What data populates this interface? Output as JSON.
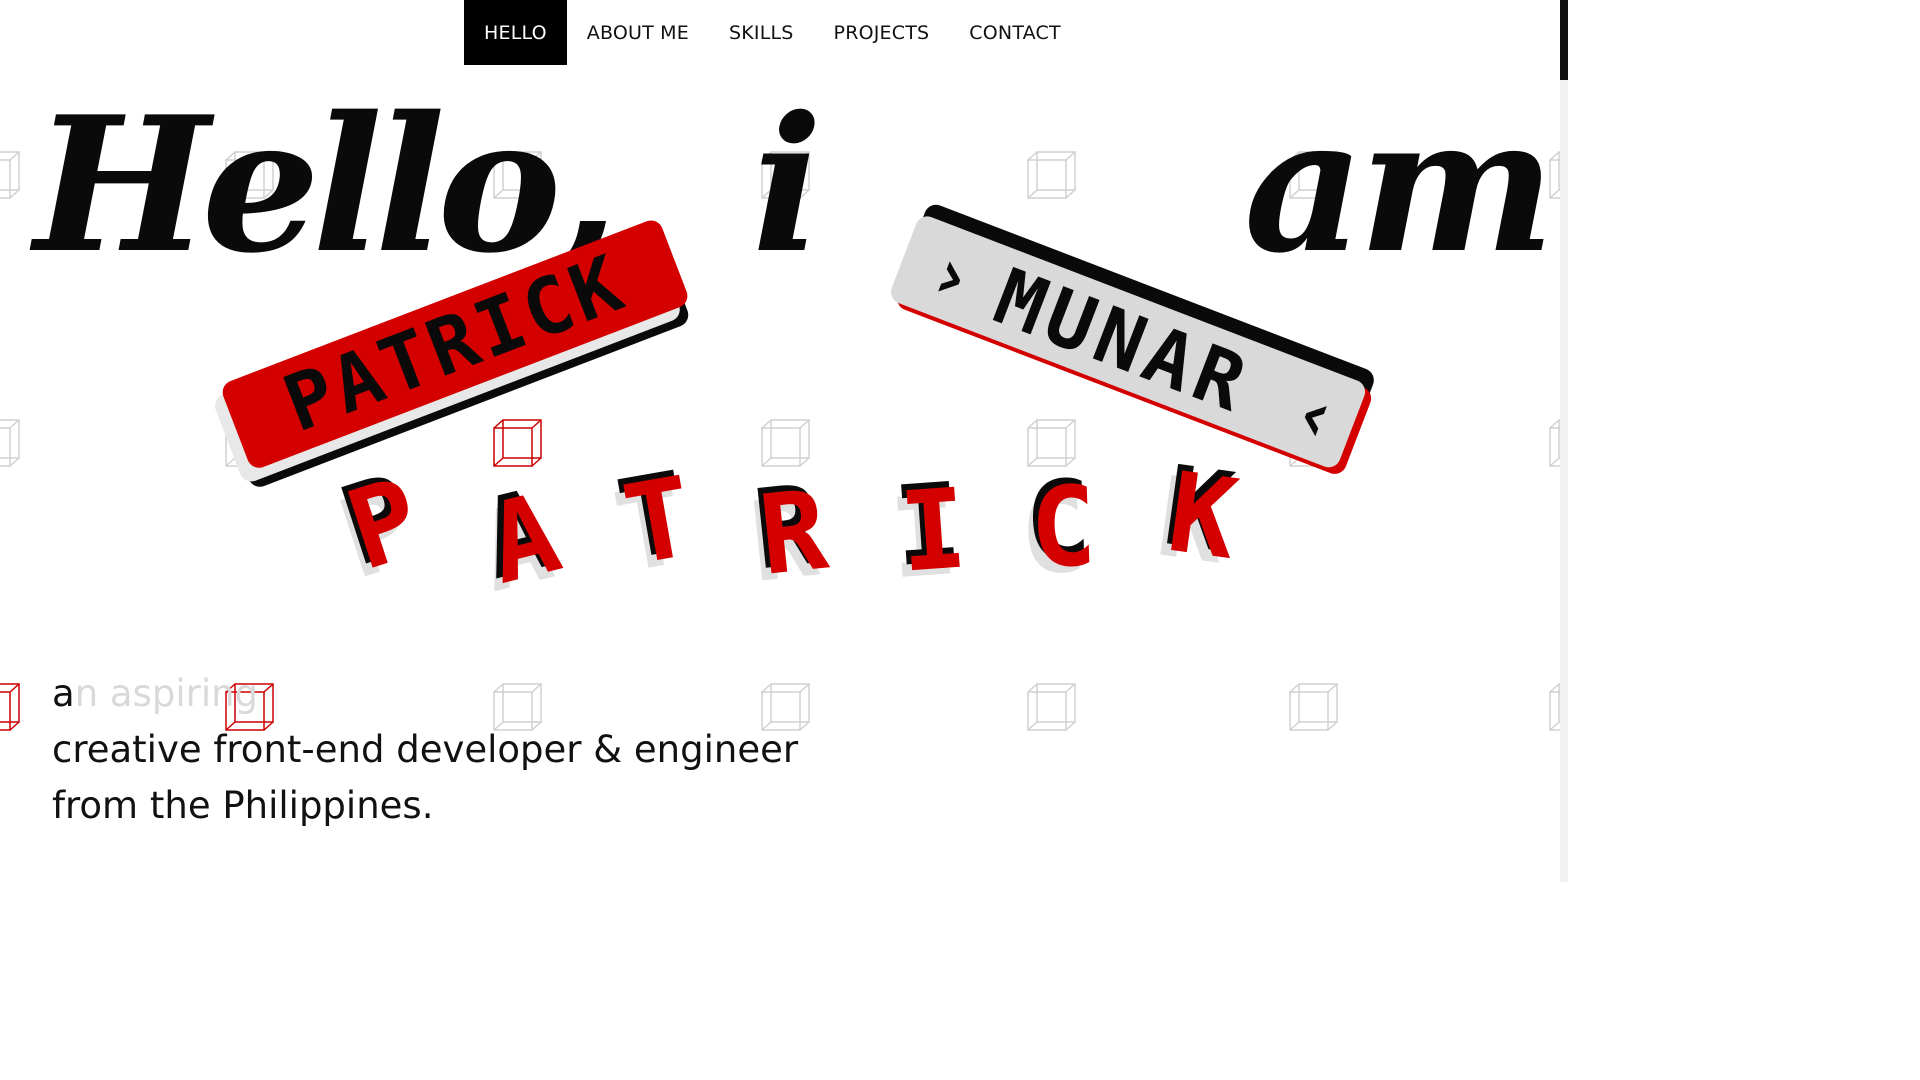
{
  "nav": {
    "items": [
      {
        "label": "HELLO",
        "active": true
      },
      {
        "label": "ABOUT ME",
        "active": false
      },
      {
        "label": "SKILLS",
        "active": false
      },
      {
        "label": "PROJECTS",
        "active": false
      },
      {
        "label": "CONTACT",
        "active": false
      }
    ]
  },
  "hero": {
    "word_hello": "Hello,",
    "word_i": "i",
    "word_am": "am",
    "plate_first_name": "PATRICK",
    "plate_last_name": "MUNAR",
    "plate_last_name_prefix": "›",
    "plate_last_name_suffix": "‹",
    "letters_3d": [
      "P",
      "A",
      "T",
      "R",
      "I",
      "C",
      "K"
    ]
  },
  "intro": {
    "typed": "a",
    "untyped": "n aspiring",
    "line2": "creative front-end developer & engineer",
    "line3": "from the Philippines."
  },
  "colors": {
    "accent": "#d40000",
    "black": "#0a0a0a",
    "plate_light": "#d9d9d9",
    "cube_outline": "#d0d0d0"
  }
}
